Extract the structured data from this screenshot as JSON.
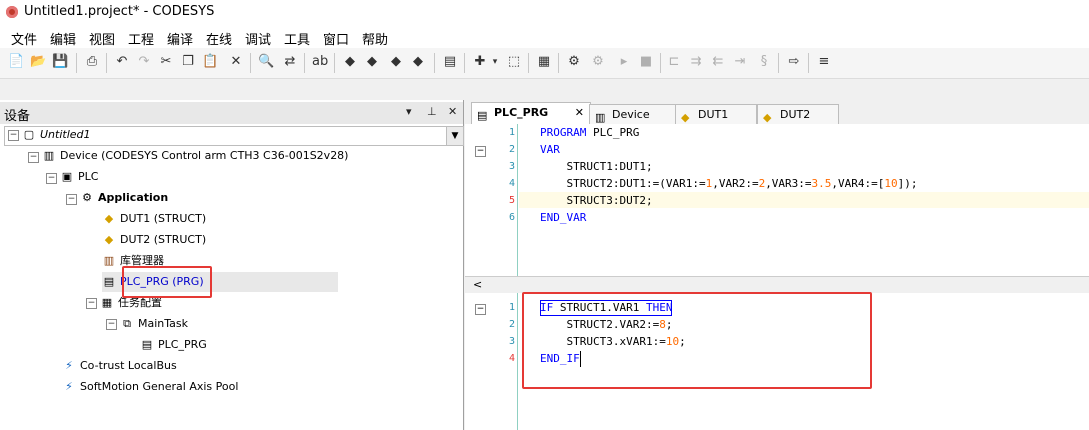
{
  "window": {
    "title": "Untitled1.project* - CODESYS"
  },
  "menu": [
    "文件",
    "编辑",
    "视图",
    "工程",
    "编译",
    "在线",
    "调试",
    "工具",
    "窗口",
    "帮助"
  ],
  "devices_panel": {
    "title": "设备",
    "controls": {
      "dropdown": "▾",
      "pin": "⊥",
      "close": "✕"
    },
    "tree": [
      {
        "label": "Untitled1",
        "italic": true
      },
      {
        "label": "Device (CODESYS Control arm CTH3 C36-001S2v28)"
      },
      {
        "label": "PLC"
      },
      {
        "label": "Application",
        "bold": true
      },
      {
        "label": "DUT1 (STRUCT)"
      },
      {
        "label": "DUT2 (STRUCT)"
      },
      {
        "label": "库管理器"
      },
      {
        "label": "PLC_PRG (PRG)",
        "selected": true
      },
      {
        "label": "任务配置"
      },
      {
        "label": "MainTask"
      },
      {
        "label": "PLC_PRG"
      },
      {
        "label": "Co-trust LocalBus"
      },
      {
        "label": "SoftMotion General Axis Pool"
      }
    ]
  },
  "editor_tabs": [
    {
      "label": "PLC_PRG",
      "active": true
    },
    {
      "label": "Device"
    },
    {
      "label": "DUT1"
    },
    {
      "label": "DUT2"
    }
  ],
  "declaration": {
    "line_numbers": [
      "1",
      "2",
      "3",
      "4",
      "5",
      "6"
    ],
    "lines": [
      [
        {
          "t": "PROGRAM",
          "k": "kw"
        },
        {
          "t": " PLC_PRG"
        }
      ],
      [
        {
          "t": "VAR",
          "k": "kw"
        }
      ],
      [
        {
          "t": "    STRUCT1:DUT1;"
        }
      ],
      [
        {
          "t": "    STRUCT2:DUT1:=(VAR1:="
        },
        {
          "t": "1",
          "k": "num"
        },
        {
          "t": ",VAR2:="
        },
        {
          "t": "2",
          "k": "num"
        },
        {
          "t": ",VAR3:="
        },
        {
          "t": "3.5",
          "k": "num"
        },
        {
          "t": ",VAR4:=["
        },
        {
          "t": "10",
          "k": "num"
        },
        {
          "t": "]);"
        }
      ],
      [
        {
          "t": "    STRUCT3:DUT2;"
        }
      ],
      [
        {
          "t": "END_VAR",
          "k": "kw"
        }
      ]
    ]
  },
  "implementation": {
    "line_numbers": [
      "1",
      "2",
      "3",
      "4"
    ],
    "lines": [
      [
        {
          "t": "IF",
          "k": "kw"
        },
        {
          "t": " STRUCT1.VAR1 "
        },
        {
          "t": "THEN",
          "k": "kw"
        }
      ],
      [
        {
          "t": "    STRUCT2.VAR2:="
        },
        {
          "t": "8",
          "k": "num"
        },
        {
          "t": ";"
        }
      ],
      [
        {
          "t": "    STRUCT3.xVAR1:="
        },
        {
          "t": "10",
          "k": "num"
        },
        {
          "t": ";"
        }
      ],
      [
        {
          "t": "END_IF",
          "k": "kw"
        }
      ]
    ]
  },
  "scroll_left_glyph": "<",
  "colors": {
    "keyword": "#0000ff",
    "number": "#ff6a00",
    "highlight_box": "#e53935"
  }
}
